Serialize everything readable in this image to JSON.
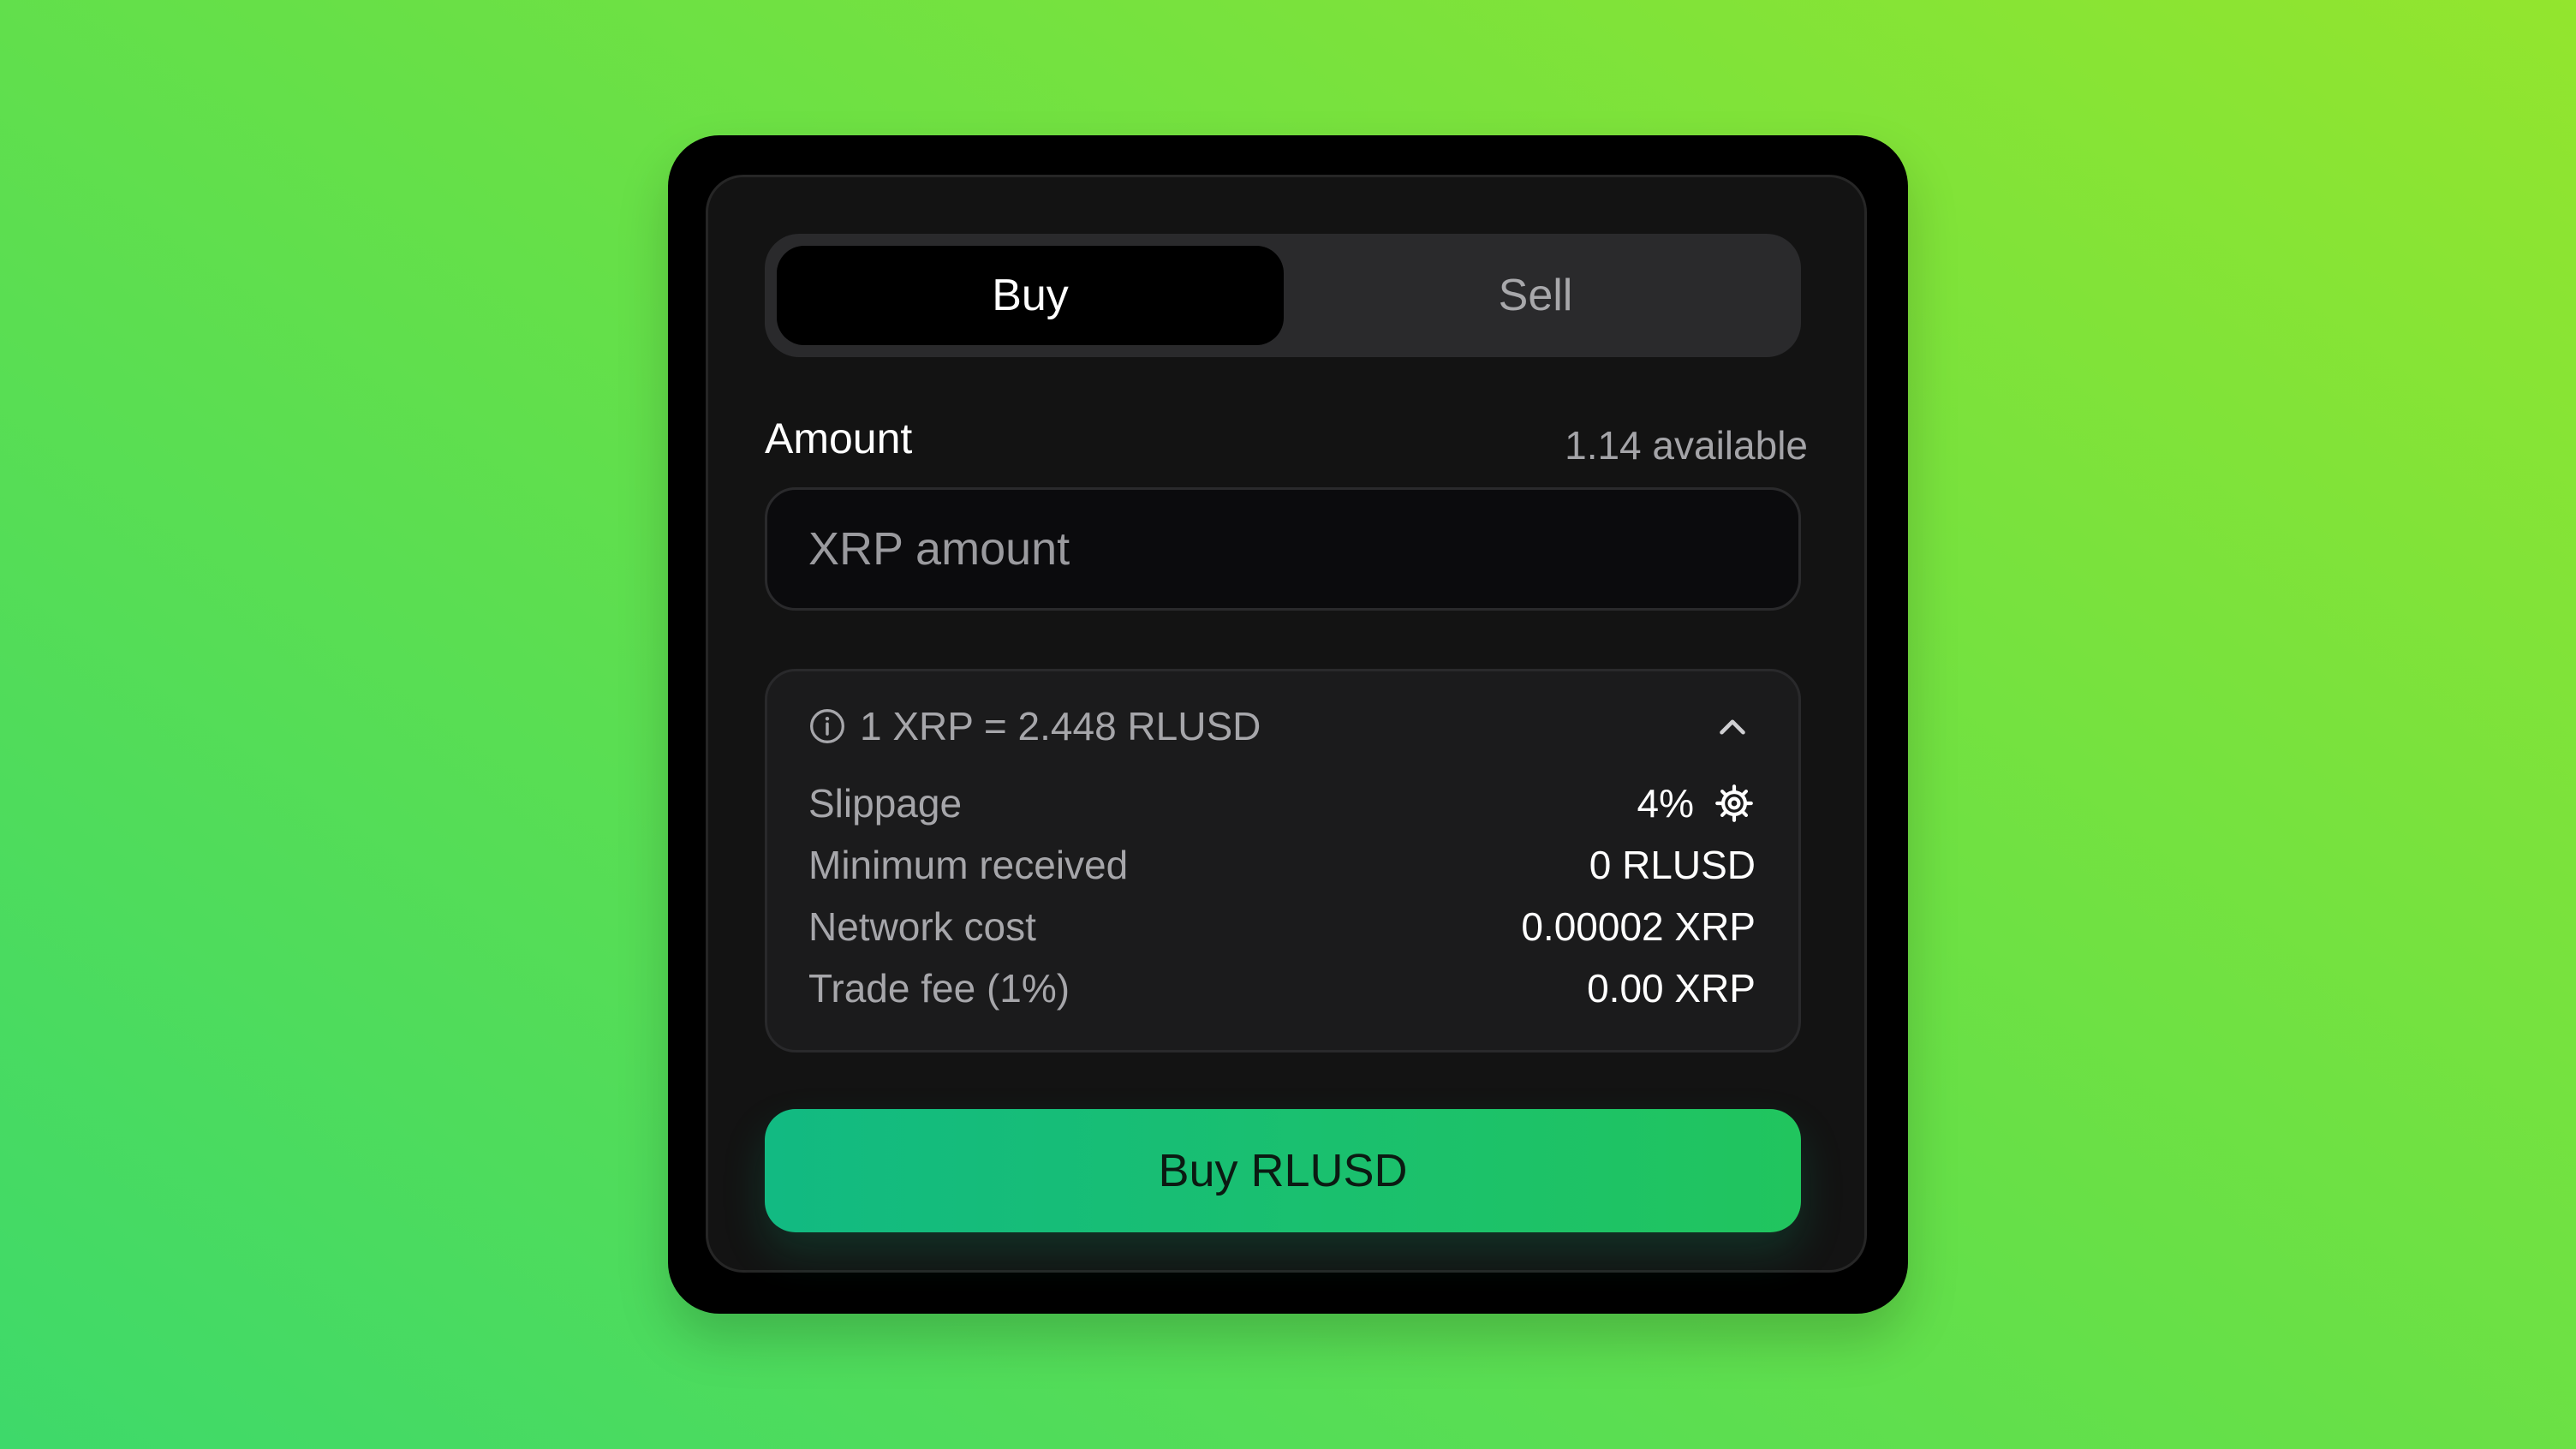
{
  "tabs": {
    "buy": "Buy",
    "sell": "Sell",
    "active": "Buy"
  },
  "amount": {
    "label": "Amount",
    "available": "1.14 available",
    "placeholder": "XRP amount",
    "value": ""
  },
  "details": {
    "rate": "1 XRP = 2.448 RLUSD",
    "expanded": true,
    "rows": [
      {
        "label": "Slippage",
        "value": "4%"
      },
      {
        "label": "Minimum received",
        "value": "0 RLUSD"
      },
      {
        "label": "Network cost",
        "value": "0.00002 XRP"
      },
      {
        "label": "Trade fee (1%)",
        "value": "0.00 XRP"
      }
    ]
  },
  "action": {
    "label": "Buy RLUSD"
  },
  "colors": {
    "accent_start": "#12ba82",
    "accent_end": "#21c55e",
    "card_bg": "#131313",
    "background_start": "#3ed96a",
    "background_end": "#93e52e"
  },
  "icons": {
    "info": "info-icon",
    "chevron": "chevron-up-icon",
    "settings": "gear-icon"
  }
}
